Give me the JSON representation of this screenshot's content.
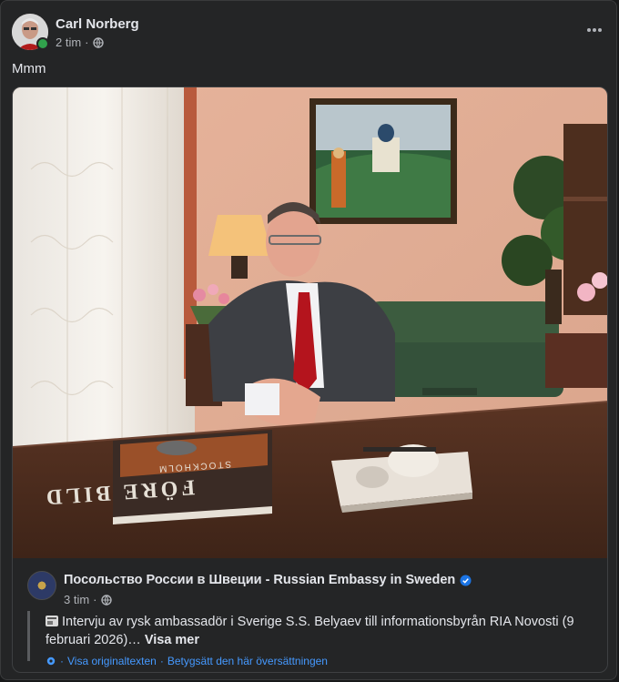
{
  "post": {
    "author": "Carl Norberg",
    "time": "2 tim",
    "separator": "·",
    "text": "Mmm"
  },
  "shared": {
    "page_name": "Посольство России в Швеции - Russian Embassy in Sweden",
    "time": "3 tim",
    "separator": "·",
    "description": "Intervju av rysk ambassadör i Sverige S.S. Belyaev till informationsbyrån RIA Novosti (9 februari 2026)…",
    "see_more": "Visa mer",
    "view_original": "Visa originaltexten",
    "rate_translation": "Betygsätt den här översättningen",
    "dot": "·",
    "book_title": "FÖRE BILD",
    "book_subtitle": "STOCKHOLM"
  },
  "colors": {
    "card_bg": "#242526",
    "accent_link": "#4599ff",
    "verified_blue": "#1b74e4",
    "online_green": "#31a24c"
  },
  "icons": [
    "globe-icon",
    "more-options-icon",
    "verified-badge-icon",
    "news-icon",
    "translate-gear-icon"
  ]
}
